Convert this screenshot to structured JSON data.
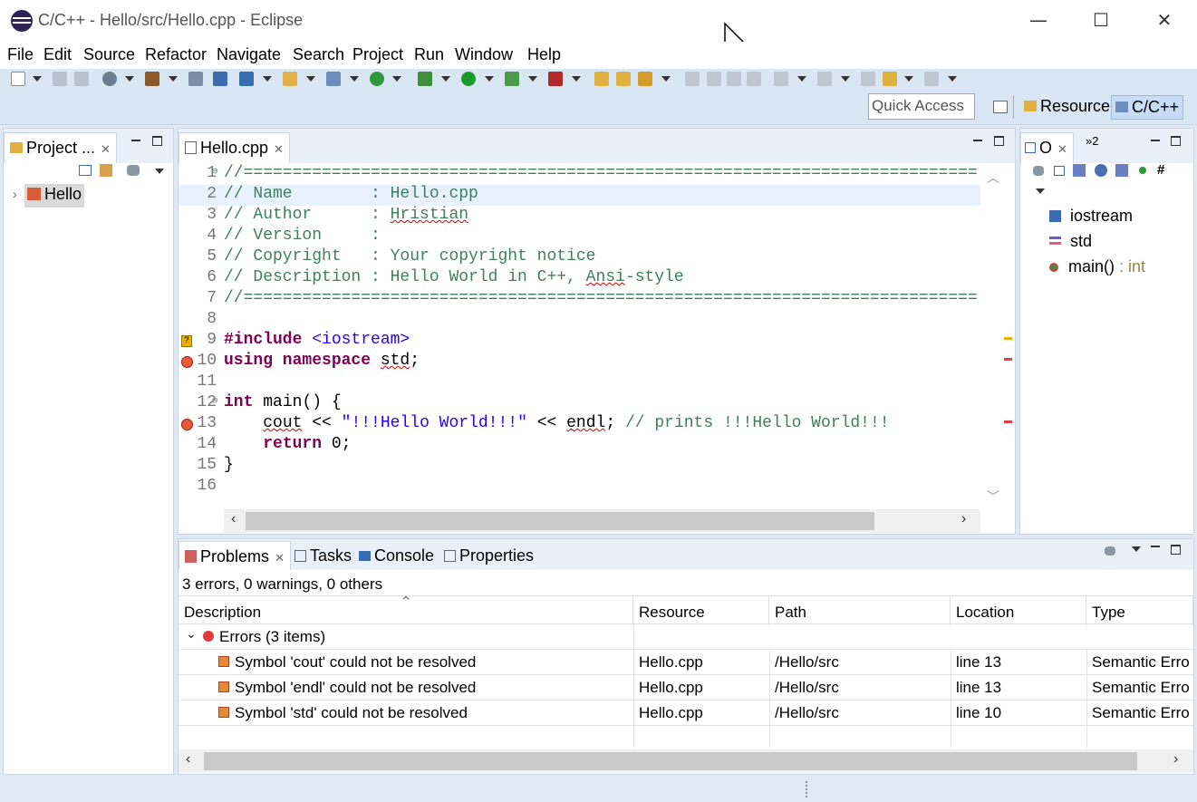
{
  "window": {
    "title": "C/C++ - Hello/src/Hello.cpp - Eclipse",
    "controls": {
      "minimize": "—",
      "maximize": "☐",
      "close": "✕"
    }
  },
  "menu": [
    "File",
    "Edit",
    "Source",
    "Refactor",
    "Navigate",
    "Search",
    "Project",
    "Run",
    "Window",
    "Help"
  ],
  "toolbar": {
    "quick_access_placeholder": "Quick Access",
    "perspectives": [
      "Resource",
      "C/C++"
    ]
  },
  "project_explorer": {
    "tab_label": "Project ...",
    "items": [
      {
        "label": "Hello"
      }
    ]
  },
  "editor": {
    "tab_label": "Hello.cpp",
    "lines": [
      {
        "n": "1",
        "fold": "⊖",
        "tokens": [
          {
            "c": "cm",
            "t": "//==========================================================================="
          }
        ]
      },
      {
        "n": "2",
        "tokens": [
          {
            "c": "cm",
            "t": "// Name        : Hello.cpp"
          }
        ]
      },
      {
        "n": "3",
        "tokens": [
          {
            "c": "cm",
            "t": "// Author      : "
          },
          {
            "c": "cm err",
            "t": "Hristian"
          }
        ]
      },
      {
        "n": "4",
        "tokens": [
          {
            "c": "cm",
            "t": "// Version     :"
          }
        ]
      },
      {
        "n": "5",
        "tokens": [
          {
            "c": "cm",
            "t": "// Copyright   : Your copyright notice"
          }
        ]
      },
      {
        "n": "6",
        "tokens": [
          {
            "c": "cm",
            "t": "// Description : Hello World in C++, "
          },
          {
            "c": "cm err",
            "t": "Ansi"
          },
          {
            "c": "cm",
            "t": "-style"
          }
        ]
      },
      {
        "n": "7",
        "tokens": [
          {
            "c": "cm",
            "t": "//==========================================================================="
          }
        ]
      },
      {
        "n": "8",
        "tokens": []
      },
      {
        "n": "9",
        "marker": "?",
        "tokens": [
          {
            "c": "kw",
            "t": "#include "
          },
          {
            "c": "str",
            "t": "<iostream>"
          }
        ]
      },
      {
        "n": "10",
        "marker": "error",
        "tokens": [
          {
            "c": "kw",
            "t": "using namespace "
          },
          {
            "c": "pl err",
            "t": "std"
          },
          {
            "c": "pl",
            "t": ";"
          }
        ]
      },
      {
        "n": "11",
        "tokens": []
      },
      {
        "n": "12",
        "fold": "⊖",
        "tokens": [
          {
            "c": "kw",
            "t": "int "
          },
          {
            "c": "pl",
            "t": "main"
          },
          {
            "c": "pl",
            "t": "() {"
          }
        ]
      },
      {
        "n": "13",
        "marker": "error",
        "tokens": [
          {
            "c": "pl",
            "t": "    "
          },
          {
            "c": "pl err",
            "t": "cout"
          },
          {
            "c": "pl",
            "t": " << "
          },
          {
            "c": "str",
            "t": "\"!!!Hello World!!!\""
          },
          {
            "c": "pl",
            "t": " << "
          },
          {
            "c": "pl err",
            "t": "endl"
          },
          {
            "c": "pl",
            "t": "; "
          },
          {
            "c": "cm",
            "t": "// prints !!!Hello World!!!"
          }
        ]
      },
      {
        "n": "14",
        "tokens": [
          {
            "c": "pl",
            "t": "    "
          },
          {
            "c": "kw",
            "t": "return "
          },
          {
            "c": "pl",
            "t": "0;"
          }
        ]
      },
      {
        "n": "15",
        "tokens": [
          {
            "c": "pl",
            "t": "}"
          }
        ]
      },
      {
        "n": "16",
        "tokens": []
      }
    ]
  },
  "outline": {
    "tab_label": "O",
    "overflow_label": "»2",
    "items": [
      {
        "label": "iostream",
        "suffix": ""
      },
      {
        "label": "std",
        "suffix": ""
      },
      {
        "label": "main()",
        "suffix": " : int"
      }
    ]
  },
  "bottom": {
    "tabs": [
      "Problems",
      "Tasks",
      "Console",
      "Properties"
    ],
    "summary": "3 errors, 0 warnings, 0 others",
    "columns": [
      "Description",
      "Resource",
      "Path",
      "Location",
      "Type"
    ],
    "group_label": "Errors (3 items)",
    "rows": [
      {
        "description": "Symbol 'cout' could not be resolved",
        "resource": "Hello.cpp",
        "path": "/Hello/src",
        "location": "line 13",
        "type": "Semantic Erro"
      },
      {
        "description": "Symbol 'endl' could not be resolved",
        "resource": "Hello.cpp",
        "path": "/Hello/src",
        "location": "line 13",
        "type": "Semantic Erro"
      },
      {
        "description": "Symbol 'std' could not be resolved",
        "resource": "Hello.cpp",
        "path": "/Hello/src",
        "location": "line 10",
        "type": "Semantic Erro"
      }
    ]
  },
  "colors": {
    "toolbar_bg": "#d9e6f4",
    "comment": "#3f7f5f",
    "keyword": "#7f0055",
    "string": "#2a00ff",
    "error": "#e85a3c"
  }
}
